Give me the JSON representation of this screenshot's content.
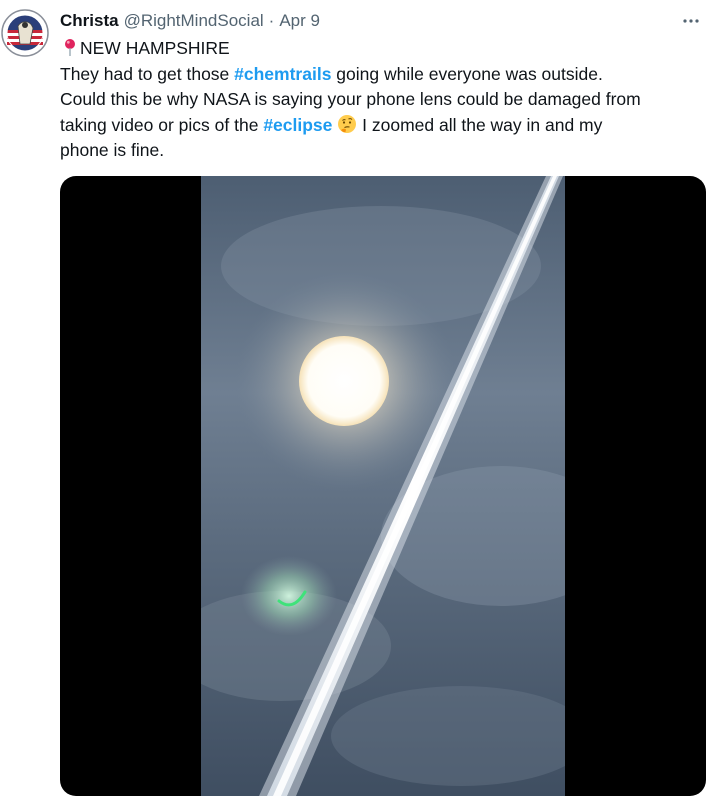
{
  "tweet": {
    "display_name": "Christa",
    "handle": "@RightMindSocial",
    "separator": "·",
    "date": "Apr 9",
    "location_line": "NEW HAMPSHIRE",
    "text_parts": {
      "p1": "They had to get those ",
      "hashtag1": "#chemtrails",
      "p2": " going while everyone was outside.",
      "line3": "Could this be why NASA is saying your phone lens could be damaged from",
      "p4": "taking video or pics of the ",
      "hashtag2": "#eclipse",
      "p5": " I zoomed all the way in and my",
      "line5": "phone is fine."
    },
    "icons": {
      "location": "round-pushpin-icon",
      "emoji": "thinking-face-icon",
      "more": "more-horizontal-icon"
    }
  },
  "colors": {
    "text": "#0f1419",
    "secondary": "#536471",
    "link": "#1d9bf0",
    "media_bg": "#000000"
  }
}
